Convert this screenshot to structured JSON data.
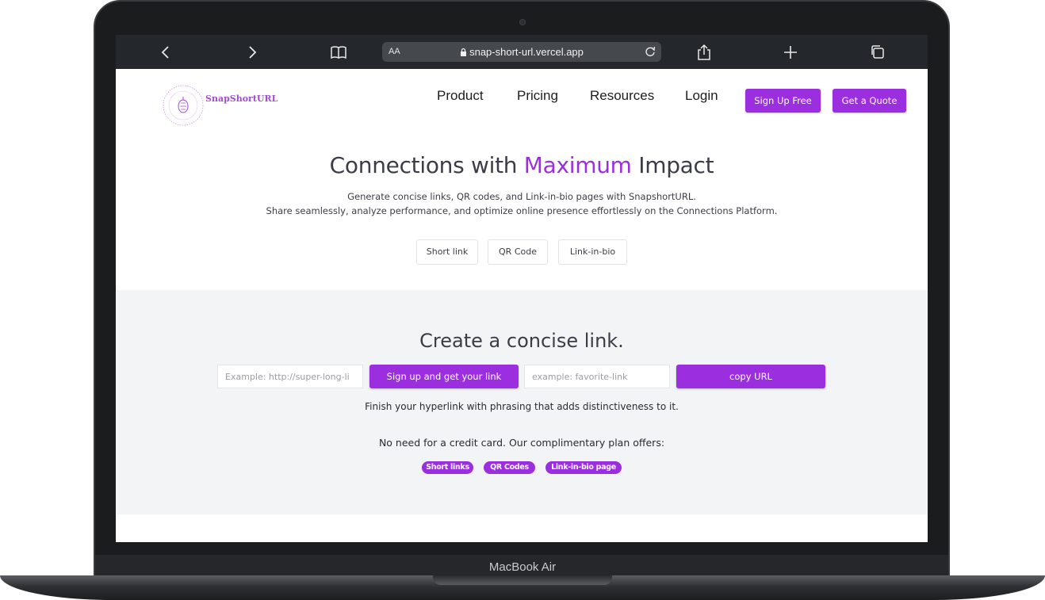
{
  "device": {
    "label": "MacBook Air"
  },
  "browser": {
    "aa_label": "AA",
    "url": "snap-short-url.vercel.app"
  },
  "site": {
    "logo_text": "SnapShortURL",
    "nav": [
      "Product",
      "Pricing",
      "Resources",
      "Login"
    ],
    "signup_label": "Sign Up Free",
    "quote_label": "Get a Quote"
  },
  "hero": {
    "title_prefix": "Connections with ",
    "title_accent": "Maximum",
    "title_suffix": " Impact",
    "line1": "Generate concise links, QR codes, and Link-in-bio pages with SnapshortURL.",
    "line2": "Share seamlessly, analyze performance, and optimize online presence effortlessly on the Connections Platform.",
    "tabs": [
      "Short link",
      "QR Code",
      "Link-in-bio"
    ]
  },
  "shortener": {
    "title": "Create a concise link.",
    "url_placeholder": "Example: http://super-long-li",
    "signup_button": "Sign up and get your link",
    "slug_placeholder": "example: favorite-link",
    "copy_button": "copy URL",
    "hint": "Finish your hyperlink with phrasing that adds distinctiveness to it.",
    "free_plan": "No need for a credit card. Our complimentary plan offers:",
    "features": [
      "Short links",
      "QR Codes",
      "Link-in-bio page"
    ]
  },
  "colors": {
    "accent": "#9b2fe0",
    "toolbar": "#24272b",
    "section_bg": "#f3f4f6"
  }
}
